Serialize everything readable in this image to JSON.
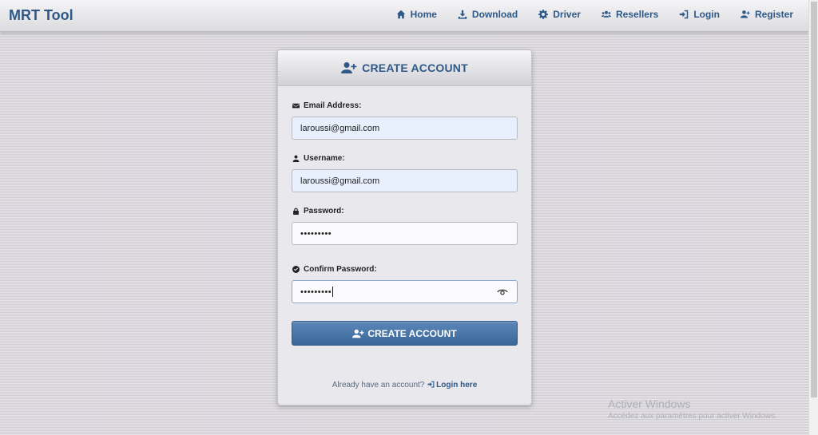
{
  "brand": "MRT Tool",
  "nav": [
    {
      "label": "Home",
      "icon": "home-icon"
    },
    {
      "label": "Download",
      "icon": "download-icon"
    },
    {
      "label": "Driver",
      "icon": "gear-icon"
    },
    {
      "label": "Resellers",
      "icon": "users-icon"
    },
    {
      "label": "Login",
      "icon": "sign-in-icon"
    },
    {
      "label": "Register",
      "icon": "user-plus-icon"
    }
  ],
  "card": {
    "title": "CREATE ACCOUNT",
    "email_label": "Email Address:",
    "email_value": "laroussi@gmail.com",
    "username_label": "Username:",
    "username_value": "laroussi@gmail.com",
    "password_label": "Password:",
    "password_value": "•••••••••",
    "confirm_label": "Confirm Password:",
    "confirm_value": "•••••••••",
    "submit_label": "CREATE ACCOUNT",
    "footer_text": "Already have an account?",
    "footer_link": "Login here"
  },
  "watermark": {
    "line1": "Activer Windows",
    "line2": "Accédez aux paramètres pour activer Windows."
  },
  "colors": {
    "accent": "#2d5888",
    "button": "#4a76a8",
    "autofill": "#e8f0fe"
  }
}
